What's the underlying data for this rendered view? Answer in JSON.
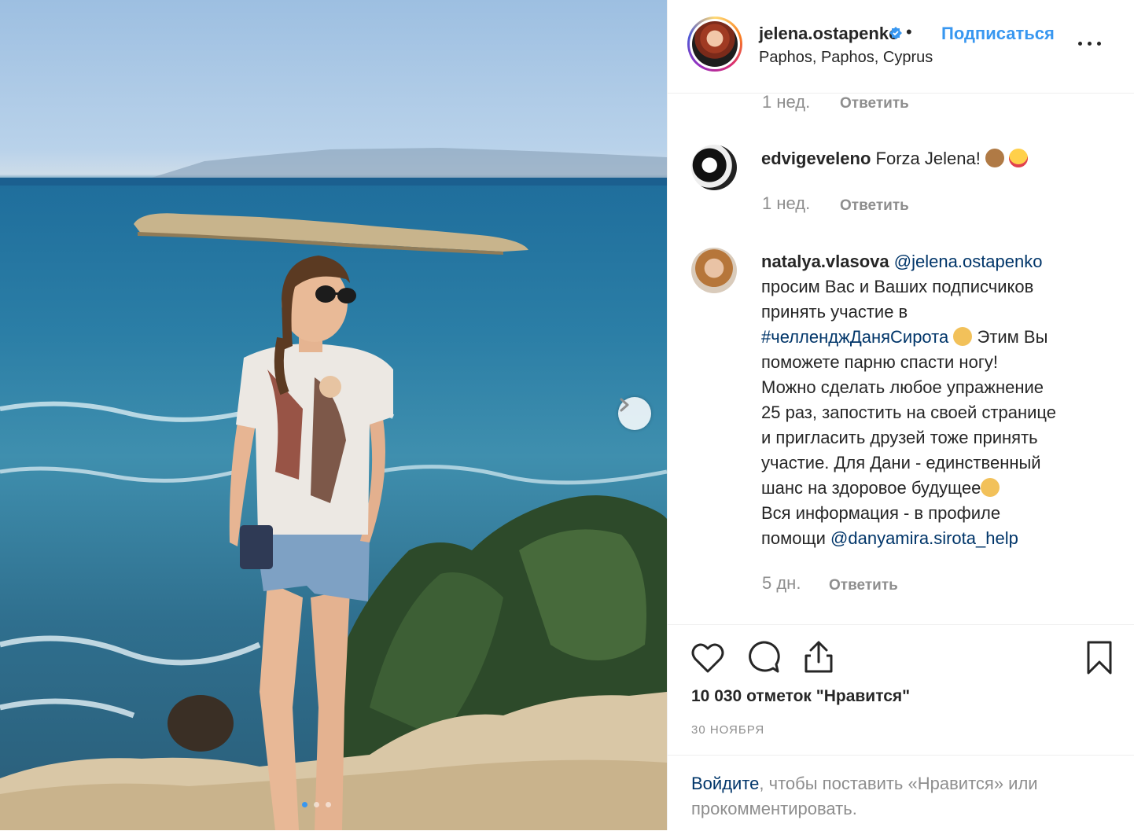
{
  "post": {
    "username": "jelena.ostapenko",
    "bullet": "•",
    "follow_label": "Подписаться",
    "location": "Paphos, Paphos, Cyprus"
  },
  "comments": [
    {
      "time": "1 нед.",
      "reply_label": "Ответить"
    },
    {
      "user": "edvigeveleno",
      "text": "Forza Jelena!",
      "time": "1 нед.",
      "reply_label": "Ответить"
    },
    {
      "user": "natalya.vlasova",
      "mention": "@jelena.ostapenko",
      "line1": "просим Вас и Ваших подписчиков",
      "line2": "принять участие в",
      "hashtag": "#челленджДаняСирота",
      "line3": "Этим Вы",
      "line4": "поможете парню спасти ногу!",
      "line5": "Можно сделать любое упражнение",
      "line6": "25 раз, запостить на своей странице",
      "line7": "и пригласить друзей тоже принять",
      "line8": "участие. Для Дани - единственный",
      "line9": "шанс на здоровое будущее",
      "line10": "Вся информация - в профиле",
      "line11": "помощи",
      "mention2": "@danyamira.sirota_help",
      "time": "5 дн.",
      "reply_label": "Ответить"
    }
  ],
  "likes": "10 030 отметок \"Нравится\"",
  "date": "30 НОЯБРЯ",
  "login": {
    "link": "Войдите",
    "text": ", чтобы поставить «Нравится» или прокомментировать."
  },
  "icons": {
    "like": "heart-icon",
    "comment": "comment-icon",
    "share": "share-icon",
    "save": "bookmark-icon",
    "more": "more-icon",
    "next": "chevron-right-icon",
    "verified": "verified-badge-icon"
  },
  "colors": {
    "link": "#3897f0",
    "mention": "#003569",
    "muted": "#8e8e8e",
    "text": "#262626"
  }
}
